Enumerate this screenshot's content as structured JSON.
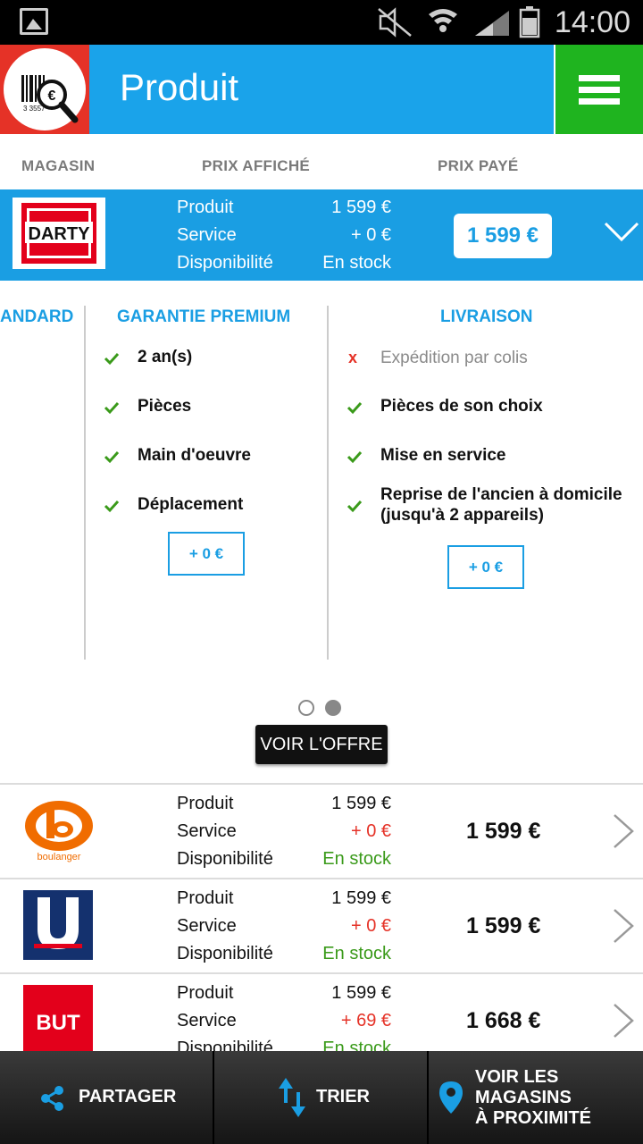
{
  "status_bar": {
    "time": "14:00"
  },
  "appbar": {
    "title": "Produit",
    "logo_digits": "3 3557"
  },
  "columns": {
    "store": "MAGASIN",
    "displayed_price": "PRIX AFFICHÉ",
    "paid_price": "PRIX PAYÉ"
  },
  "selected": {
    "store_logo": "DARTY",
    "labels": {
      "product": "Produit",
      "service": "Service",
      "availability": "Disponibilité"
    },
    "product_price": "1 599 €",
    "service_price": "+ 0 €",
    "availability": "En stock",
    "paid_price": "1 599 €"
  },
  "carousel": {
    "prev_title": "ANDARD",
    "premium": {
      "title": "GARANTIE PREMIUM",
      "items": [
        "2 an(s)",
        "Pièces",
        "Main d'oeuvre",
        "Déplacement"
      ],
      "button": "+ 0 €"
    },
    "delivery": {
      "title": "LIVRAISON",
      "unavailable": "Expédition par colis",
      "items": [
        "Pièces de son choix",
        "Mise en service",
        "Reprise de l'ancien à domicile",
        "(jusqu'à 2 appareils)"
      ],
      "button": "+ 0 €"
    }
  },
  "voir_offre": "VOIR L'OFFRE",
  "offers": [
    {
      "store": "boulanger",
      "product": "1 599 €",
      "service": "+ 0 €",
      "availability": "En stock",
      "total": "1 599 €"
    },
    {
      "store": "U",
      "product": "1 599 €",
      "service": "+ 0 €",
      "availability": "En stock",
      "total": "1 599 €"
    },
    {
      "store": "BUT",
      "product": "1 599 €",
      "service": "+ 69 €",
      "availability": "En stock",
      "total": "1 668 €"
    }
  ],
  "offer_labels": {
    "product": "Produit",
    "service": "Service",
    "availability": "Disponibilité"
  },
  "bottom_bar": {
    "share": "PARTAGER",
    "sort": "TRIER",
    "nearby_line1": "VOIR LES",
    "nearby_line2": "MAGASINS",
    "nearby_line3": "À PROXIMITÉ"
  },
  "colors": {
    "accent": "#1a9ee3",
    "green": "#1fb41f",
    "red": "#e53227",
    "stock": "#3a9a1a",
    "service_red": "#e53227"
  }
}
